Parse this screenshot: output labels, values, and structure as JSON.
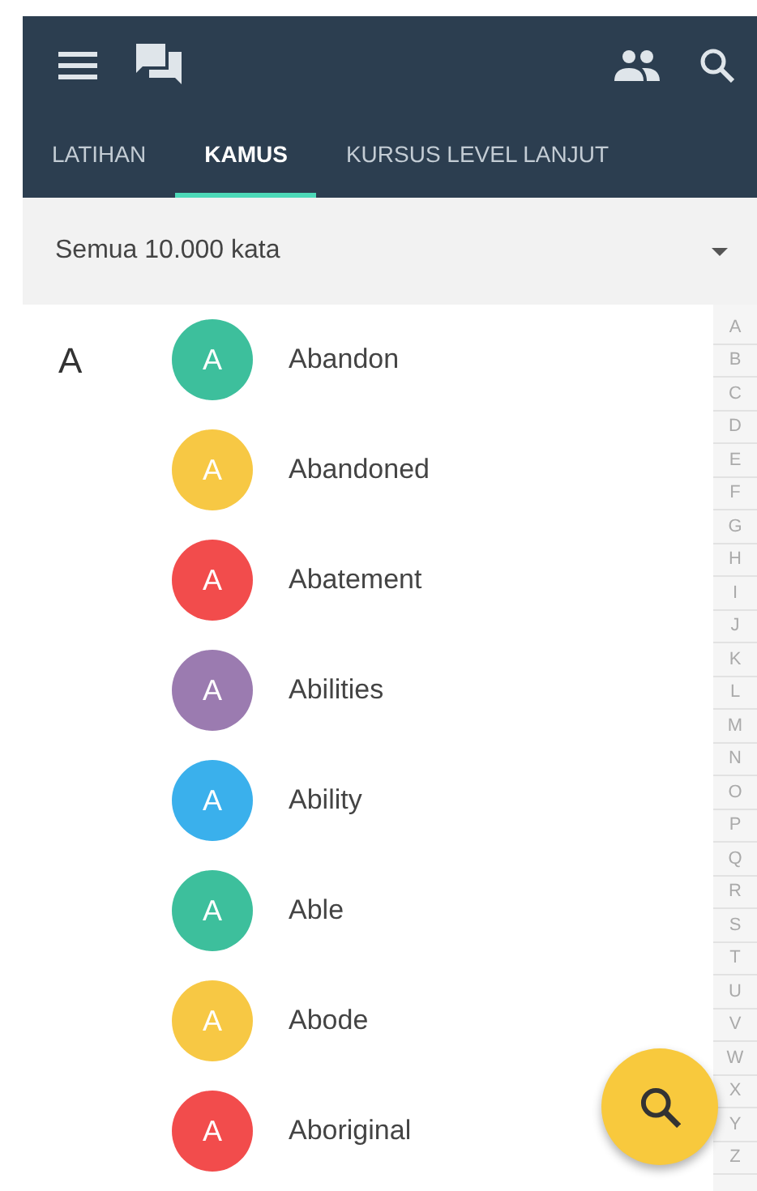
{
  "tabs": [
    {
      "label": "LATIHAN",
      "selected": false
    },
    {
      "label": "KAMUS",
      "selected": true
    },
    {
      "label": "KURSUS LEVEL LANJUT",
      "selected": false
    }
  ],
  "filter": {
    "value": "Semua 10.000 kata"
  },
  "section_letter": "A",
  "words": [
    {
      "initial": "A",
      "word": "Abandon",
      "color": "#3dbf9c"
    },
    {
      "initial": "A",
      "word": "Abandoned",
      "color": "#f7c844"
    },
    {
      "initial": "A",
      "word": "Abatement",
      "color": "#f24c4c"
    },
    {
      "initial": "A",
      "word": "Abilities",
      "color": "#9b7bb0"
    },
    {
      "initial": "A",
      "word": "Ability",
      "color": "#3ab0ec"
    },
    {
      "initial": "A",
      "word": "Able",
      "color": "#3dbf9c"
    },
    {
      "initial": "A",
      "word": "Abode",
      "color": "#f7c844"
    },
    {
      "initial": "A",
      "word": "Aboriginal",
      "color": "#f24c4c"
    }
  ],
  "index_letters": [
    "A",
    "B",
    "C",
    "D",
    "E",
    "F",
    "G",
    "H",
    "I",
    "J",
    "K",
    "L",
    "M",
    "N",
    "O",
    "P",
    "Q",
    "R",
    "S",
    "T",
    "U",
    "V",
    "W",
    "X",
    "Y",
    "Z"
  ]
}
